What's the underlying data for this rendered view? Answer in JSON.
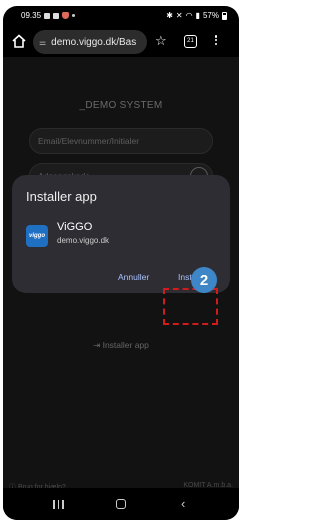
{
  "status_bar": {
    "time": "09.35",
    "battery": "57%"
  },
  "browser": {
    "url": "demo.viggo.dk/Bas",
    "tab_count": "21"
  },
  "login_page": {
    "title": "_DEMO SYSTEM",
    "username_placeholder": "Email/Elevnummer/Initialer",
    "password_placeholder": "Adgangskode",
    "installer_link": "Installer app",
    "help_link": "Brug for hjælp?",
    "footer_brand": "KOMIT A.m.b.a."
  },
  "dialog": {
    "title": "Installer app",
    "app_name": "ViGGO",
    "app_url": "demo.viggo.dk",
    "icon_text": "viggo",
    "cancel_label": "Annuller",
    "install_label": "Installer"
  },
  "annotation": {
    "step_number": "2",
    "highlight_color": "#d11c1c",
    "badge_color": "#3f86c6"
  }
}
